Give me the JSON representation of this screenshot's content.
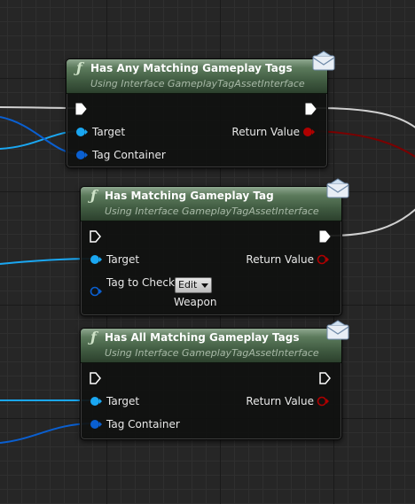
{
  "nodes": [
    {
      "title": "Has Any Matching Gameplay Tags",
      "subtitle": "Using Interface GameplayTagAssetInterface",
      "pins": {
        "target": "Target",
        "tag_container": "Tag Container",
        "return_value": "Return Value"
      }
    },
    {
      "title": "Has Matching Gameplay Tag",
      "subtitle": "Using Interface GameplayTagAssetInterface",
      "pins": {
        "target": "Target",
        "tag_to_check": "Tag to Check",
        "return_value": "Return Value"
      },
      "tag_edit": {
        "label": "Edit",
        "value": "Weapon"
      }
    },
    {
      "title": "Has All Matching Gameplay Tags",
      "subtitle": "Using Interface GameplayTagAssetInterface",
      "pins": {
        "target": "Target",
        "tag_container": "Tag Container",
        "return_value": "Return Value"
      }
    }
  ],
  "icons": {
    "function": "function-icon",
    "message": "message-envelope-icon"
  },
  "colors": {
    "object_pin": "#1aa7f2",
    "struct_pin": "#0a5fd0",
    "bool_pin": "#950000",
    "exec_wire": "#dcdcdc",
    "header_green": "#4a6a4b"
  }
}
